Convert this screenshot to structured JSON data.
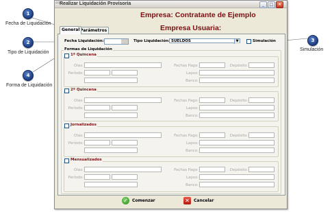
{
  "window": {
    "title": "Realizar Liquidación Provisoria",
    "icon": "app-icon",
    "controls": [
      "minimize-icon",
      "maximize-icon",
      "close-icon"
    ]
  },
  "header": {
    "empresa": "Empresa: Contratante de Ejemplo",
    "usuaria": "Empresa Usuaria:"
  },
  "tabs": [
    {
      "label": "General",
      "active": true
    },
    {
      "label": "Parámetros",
      "active": false
    }
  ],
  "top_fields": {
    "fecha_label": "Fecha Liquidación:",
    "fecha_value": "",
    "tipo_label": "Tipo Liquidación:",
    "tipo_value": "SUELDOS",
    "simulacion_label": "Simulación",
    "simulacion_checked": false
  },
  "formas": {
    "title": "Formas de Liquidación",
    "field_labels": {
      "olas": "Olas:",
      "periodo": "Período:",
      "fechas_pago": "Fechas Pago:",
      "deposito": "Depósito:",
      "lapso": "Lapso:",
      "banco": "Banco:"
    },
    "sections": [
      {
        "name": "1º Quincena",
        "checked": false
      },
      {
        "name": "2º Quincena",
        "checked": false
      },
      {
        "name": "Jornalizados",
        "checked": false
      },
      {
        "name": "Mensualizados",
        "checked": false
      }
    ]
  },
  "footer": {
    "comenzar": "Comenzar",
    "cancelar": "Cancelar"
  },
  "callouts": [
    {
      "number": "1",
      "label": "Fecha de Liquidación"
    },
    {
      "number": "2",
      "label": "Tipo de Liquidación"
    },
    {
      "number": "3",
      "label": "Simulación"
    },
    {
      "number": "4",
      "label": "Forma de Liquidación"
    }
  ],
  "colors": {
    "heading": "#7a0f12",
    "callout": "#1d3d80",
    "window_bg": "#ece9d8"
  }
}
